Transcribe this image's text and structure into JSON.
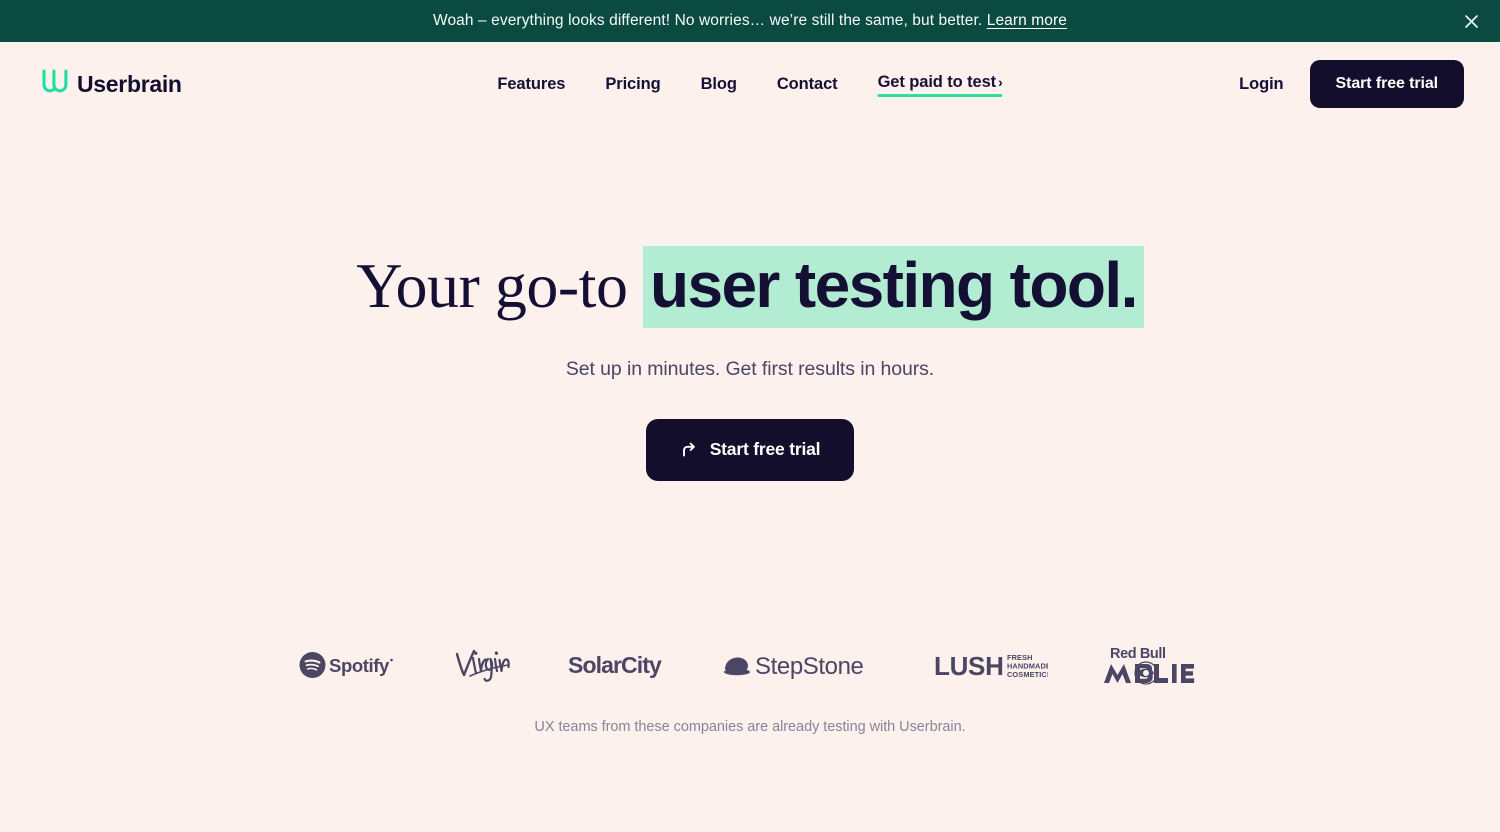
{
  "theme": {
    "page_bg": "#FDF1EE",
    "banner_bg": "#0B4A40",
    "ink": "#141033",
    "button_dark": "#120E2B",
    "accent_mint": "#B2EDD3",
    "accent_green": "#2BE1A1",
    "muted_text": "#8A8399"
  },
  "banner": {
    "text_before": "Woah – everything looks different! No worries… we’re still the same, but better. ",
    "link_label": "Learn more",
    "close_icon": "close-icon"
  },
  "header": {
    "logo": {
      "icon": "userbrain-u-logo-icon",
      "text": "Userbrain"
    },
    "nav": [
      {
        "label": "Features",
        "highlight": false
      },
      {
        "label": "Pricing",
        "highlight": false
      },
      {
        "label": "Blog",
        "highlight": false
      },
      {
        "label": "Contact",
        "highlight": false
      },
      {
        "label": "Get paid to test",
        "highlight": true,
        "chevron": "›"
      }
    ],
    "login_label": "Login",
    "cta_label": "Start free trial"
  },
  "hero": {
    "headline_plain": "Your go-to ",
    "headline_highlight": "user testing tool.",
    "subhead": "Set up in minutes. Get first results in hours.",
    "cta_label": "Start free trial",
    "cta_icon": "arrow-turn-up-right-icon"
  },
  "social_proof": {
    "caption": "UX teams from these companies are already testing with Userbrain.",
    "logos": [
      {
        "name": "spotify-logo",
        "label": "Spotify"
      },
      {
        "name": "virgin-logo",
        "label": "Virgin"
      },
      {
        "name": "solarcity-logo",
        "label": "SolarCity"
      },
      {
        "name": "stepstone-logo",
        "label": "StepStone"
      },
      {
        "name": "lush-logo",
        "label": "LUSH",
        "sub": "FRESH HANDMADE COSMETICS"
      },
      {
        "name": "redbull-mobile-logo",
        "label": "Red Bull MOBILE"
      }
    ]
  }
}
